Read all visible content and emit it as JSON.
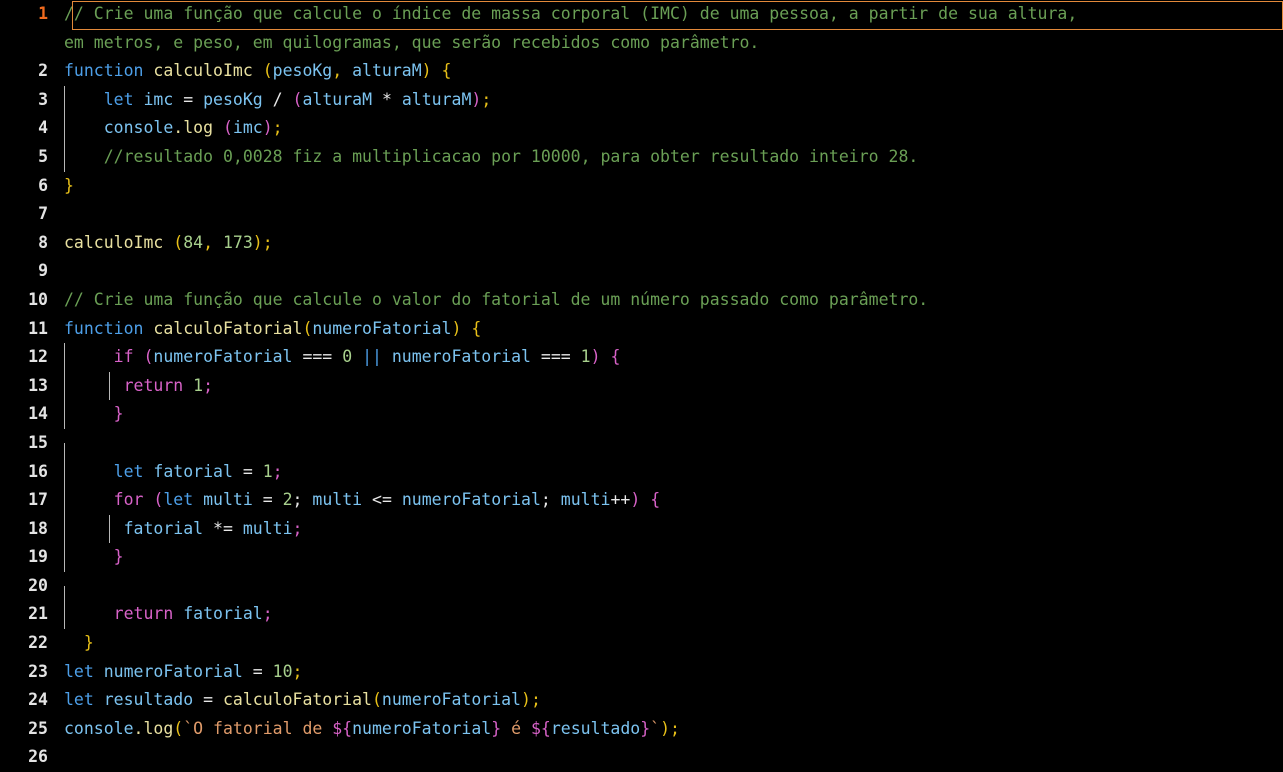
{
  "editor": {
    "language": "javascript",
    "active_line": 1,
    "theme": {
      "background": "#000000",
      "gutter_text": "#e4e4e4",
      "active_line_number": "#f06a1e",
      "active_line_border": "#e2893a",
      "comment": "#6a9f55",
      "keyword": "#4d9fe8",
      "keyword_control": "#d862c8",
      "function_name": "#e8e0a0",
      "variable": "#7cc3f0",
      "number": "#a8d08d",
      "string": "#e09b6a",
      "bracket_level_1": "#e8c018",
      "bracket_level_2": "#d862c8",
      "bracket_level_3": "#4d9fe8",
      "indent_guide": "#b8b8b8"
    }
  },
  "lines": {
    "n1": "1",
    "n2": "2",
    "n3": "3",
    "n4": "4",
    "n5": "5",
    "n6": "6",
    "n7": "7",
    "n8": "8",
    "n9": "9",
    "n10": "10",
    "n11": "11",
    "n12": "12",
    "n13": "13",
    "n14": "14",
    "n15": "15",
    "n16": "16",
    "n17": "17",
    "n18": "18",
    "n19": "19",
    "n20": "20",
    "n21": "21",
    "n22": "22",
    "n23": "23",
    "n24": "24",
    "n25": "25",
    "n26": "26"
  },
  "code": {
    "l1_comment": "// Crie uma função que calcule o índice de massa corporal (IMC) de uma pessoa, a partir de sua altura,",
    "l1b_comment": "em metros, e peso, em quilogramas, que serão recebidos como parâmetro.",
    "l2_kw": "function",
    "l2_name": "calculoImc",
    "l2_paren_open": " (",
    "l2_p1": "pesoKg",
    "l2_comma": ",",
    "l2_p2": "alturaM",
    "l2_paren_close": ")",
    "l2_brace": " {",
    "l3_let": "let",
    "l3_var": "imc",
    "l3_eq": "=",
    "l3_a": "pesoKg",
    "l3_div": "/",
    "l3_open": "(",
    "l3_b": "alturaM",
    "l3_mul": "*",
    "l3_c": "alturaM",
    "l3_close": ")",
    "l3_semi": ";",
    "l4_console": "console",
    "l4_dot_log": ".log",
    "l4_open": " (",
    "l4_arg": "imc",
    "l4_close": ")",
    "l4_semi": ";",
    "l5_comment": "//resultado 0,0028 fiz a multiplicacao por 10000, para obter resultado inteiro 28.",
    "l6_brace": "}",
    "l8_name": "calculoImc",
    "l8_open": " (",
    "l8_n1": "84",
    "l8_comma": ", ",
    "l8_n2": "173",
    "l8_close": ")",
    "l8_semi": ";",
    "l10_comment": "// Crie uma função que calcule o valor do fatorial de um número passado como parâmetro.",
    "l11_kw": "function",
    "l11_name": "calculoFatorial",
    "l11_open": "(",
    "l11_param": "numeroFatorial",
    "l11_close": ")",
    "l11_brace": " {",
    "l12_if": "if",
    "l12_open": " (",
    "l12_v1": "numeroFatorial",
    "l12_eq1": "===",
    "l12_n0": "0",
    "l12_or": "||",
    "l12_v2": "numeroFatorial",
    "l12_eq2": "===",
    "l12_n1": "1",
    "l12_close": ")",
    "l12_brace": " {",
    "l13_return": "return",
    "l13_num": "1",
    "l13_semi": ";",
    "l14_brace": "}",
    "l16_let": "let",
    "l16_var": "fatorial",
    "l16_eq": "=",
    "l16_num": "1",
    "l16_semi": ";",
    "l17_for": "for",
    "l17_open": " (",
    "l17_let": "let",
    "l17_v": "multi",
    "l17_eq": "=",
    "l17_n2": "2",
    "l17_semi1": ";",
    "l17_v2": "multi",
    "l17_lte": "<=",
    "l17_v3": "numeroFatorial",
    "l17_semi2": ";",
    "l17_v4": "multi",
    "l17_inc": "++",
    "l17_close": ")",
    "l17_brace": " {",
    "l18_v": "fatorial",
    "l18_op": "*=",
    "l18_v2": "multi",
    "l18_semi": ";",
    "l19_brace": "}",
    "l21_return": "return",
    "l21_v": "fatorial",
    "l21_semi": ";",
    "l22_brace": "}",
    "l23_let": "let",
    "l23_v": "numeroFatorial",
    "l23_eq": "=",
    "l23_num": "10",
    "l23_semi": ";",
    "l24_let": "let",
    "l24_v": "resultado",
    "l24_eq": "=",
    "l24_fn": "calculoFatorial",
    "l24_open": "(",
    "l24_arg": "numeroFatorial",
    "l24_close": ")",
    "l24_semi": ";",
    "l25_console": "console",
    "l25_dot_log": ".log",
    "l25_open": "(",
    "l25_tick1": "`",
    "l25_s1": "O fatorial de ",
    "l25_tpl1_open": "${",
    "l25_tpl1_var": "numeroFatorial",
    "l25_tpl1_close": "}",
    "l25_s2": " é ",
    "l25_tpl2_open": "${",
    "l25_tpl2_var": "resultado",
    "l25_tpl2_close": "}",
    "l25_tick2": "`",
    "l25_close": ")",
    "l25_semi": ";"
  }
}
